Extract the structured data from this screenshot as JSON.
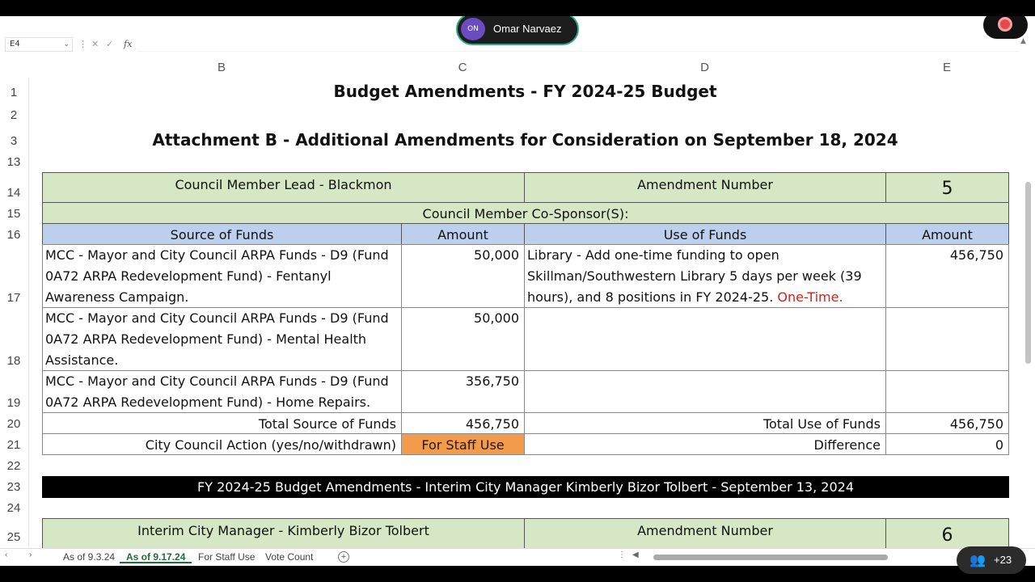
{
  "formula_bar": {
    "cell_ref": "E4",
    "fx": "fx"
  },
  "participant": {
    "initials": "ON",
    "name": "Omar Narvaez"
  },
  "columns": [
    "B",
    "C",
    "D",
    "E"
  ],
  "rows": [
    "1",
    "2",
    "3",
    "13",
    "14",
    "15",
    "16",
    "17",
    "18",
    "19",
    "20",
    "21",
    "22",
    "23",
    "24",
    "25"
  ],
  "sheet": {
    "title1": "Budget Amendments - FY 2024-25 Budget",
    "title2": "Attachment B - Additional Amendments for Consideration on September 18, 2024",
    "lead": "Council Member Lead - Blackmon",
    "amendment_number_label": "Amendment Number",
    "amendment_number": "5",
    "cosponsor": "Council Member Co-Sponsor(S):",
    "hdr_source": "Source of Funds",
    "hdr_amount": "Amount",
    "hdr_use": "Use of Funds",
    "hdr_amount2": "Amount",
    "src1": "MCC - Mayor and City Council ARPA Funds - D9 (Fund 0A72 ARPA Redevelopment Fund) - Fentanyl Awareness Campaign.",
    "amt1": "50,000",
    "use1": "Library - Add one-time funding to open Skillman/Southwestern Library 5 days per week (39 hours), and 8 positions in FY 2024-25.",
    "use1_red": "One-Time.",
    "amt_use1": "456,750",
    "src2": "MCC - Mayor and City Council ARPA Funds - D9 (Fund 0A72 ARPA Redevelopment Fund) - Mental Health Assistance.",
    "amt2": "50,000",
    "src3": "MCC - Mayor and City Council ARPA Funds - D9 (Fund 0A72 ARPA Redevelopment Fund) - Home Repairs.",
    "amt3": "356,750",
    "total_source_label": "Total Source of Funds",
    "total_source": "456,750",
    "total_use_label": "Total Use of Funds",
    "total_use": "456,750",
    "action_label": "City Council Action (yes/no/withdrawn)",
    "action_value": "For Staff Use",
    "difference_label": "Difference",
    "difference": "0",
    "section2_title": "FY 2024-25 Budget Amendments - Interim City Manager Kimberly Bizor Tolbert - September 13, 2024",
    "lead2": "Interim City Manager - Kimberly Bizor Tolbert",
    "amendment_number_label2": "Amendment Number",
    "amendment_number2": "6"
  },
  "tabs": [
    "As of 9.3.24",
    "As of 9.17.24",
    "For Staff Use",
    "Vote Count"
  ],
  "active_tab": "As of 9.17.24",
  "people_count": "+23"
}
